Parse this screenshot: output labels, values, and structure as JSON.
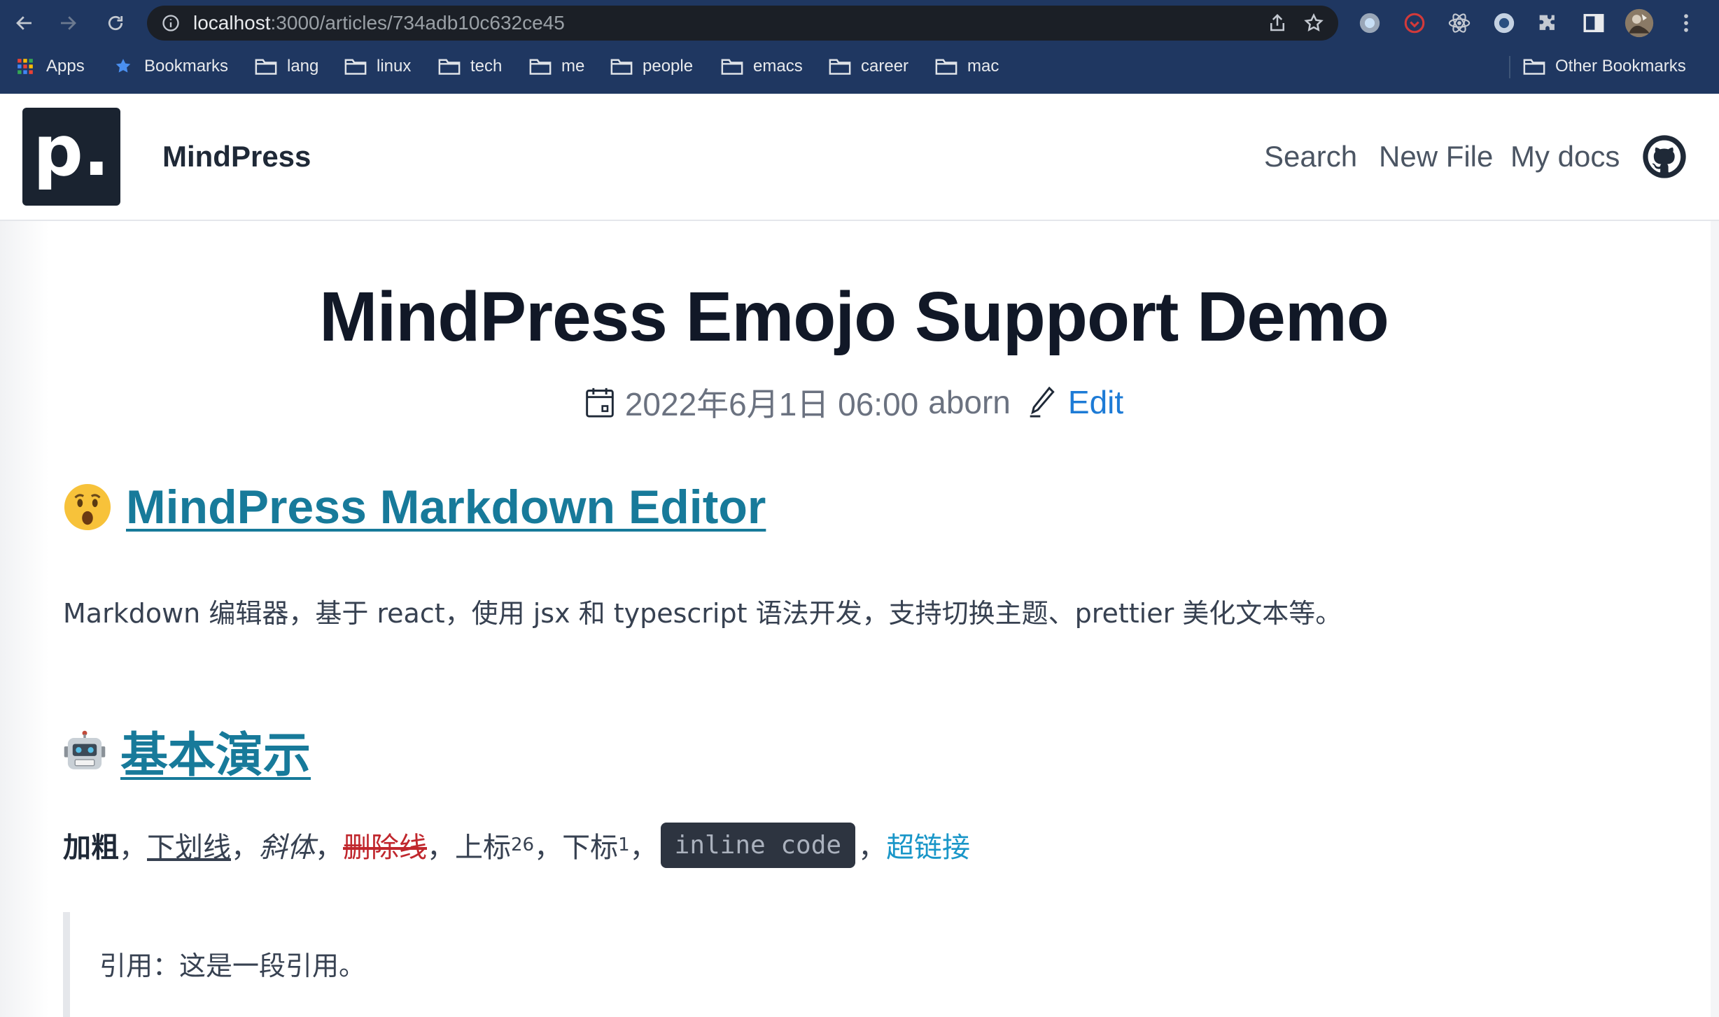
{
  "browser": {
    "url_host": "localhost",
    "url_path": ":3000/articles/734adb10c632ce45",
    "bookmarks": [
      "Apps",
      "Bookmarks",
      "lang",
      "linux",
      "tech",
      "me",
      "people",
      "emacs",
      "career",
      "mac"
    ],
    "other_bookmarks": "Other Bookmarks"
  },
  "site": {
    "logo_letter": "p.",
    "brand": "MindPress",
    "nav": [
      "Search",
      "New File",
      "My docs"
    ]
  },
  "article": {
    "title": "MindPress Emojo Support Demo",
    "date": "2022年6月1日 06:00",
    "author": "aborn",
    "edit_label": "Edit",
    "heading1": "MindPress Markdown Editor",
    "paragraph": "Markdown 编辑器，基于 react，使用 jsx 和 typescript 语法开发，支持切换主题、prettier 美化文本等。",
    "heading2": "基本演示",
    "inline": {
      "bold": "加粗",
      "sep": "，",
      "underline": "下划线",
      "italic": "斜体",
      "strike": "删除线",
      "sup_base": "上标",
      "sup": "26",
      "sub_base": "下标",
      "sub": "1",
      "code": "inline code",
      "link": "超链接"
    },
    "quote": "引用：这是一段引用。"
  }
}
